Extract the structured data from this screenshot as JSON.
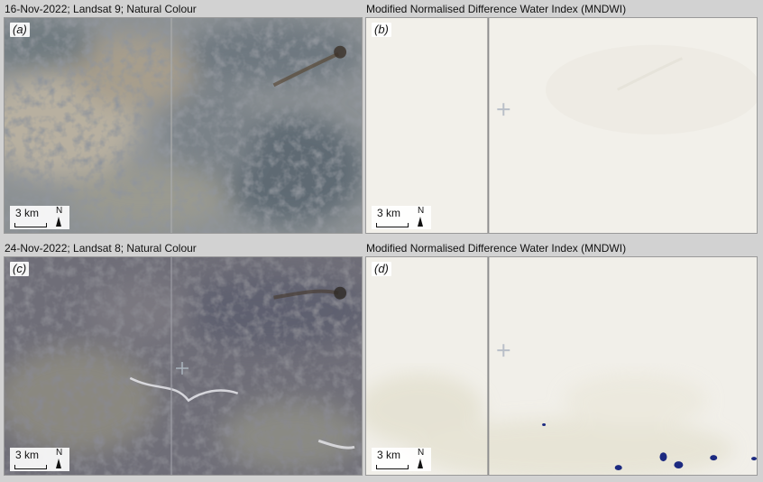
{
  "rows": [
    {
      "left_header": "16-Nov-2022; Landsat 9; Natural Colour",
      "right_header": "Modified Normalised Difference Water Index (MNDWI)"
    },
    {
      "left_header": "24-Nov-2022; Landsat 8; Natural Colour",
      "right_header": "Modified Normalised Difference Water Index (MNDWI)"
    }
  ],
  "panels": [
    {
      "label": "(a)"
    },
    {
      "label": "(b)"
    },
    {
      "label": "(c)"
    },
    {
      "label": "(d)"
    }
  ],
  "scale_bar": {
    "text": "3 km",
    "north": "N"
  },
  "colors": {
    "satellite_a_base": "#8a8f92",
    "satellite_c_base": "#6f6e78",
    "mndwi_background": "#f1efe9",
    "water": "#1c2a80",
    "panel_border": "#9a9a9a"
  }
}
